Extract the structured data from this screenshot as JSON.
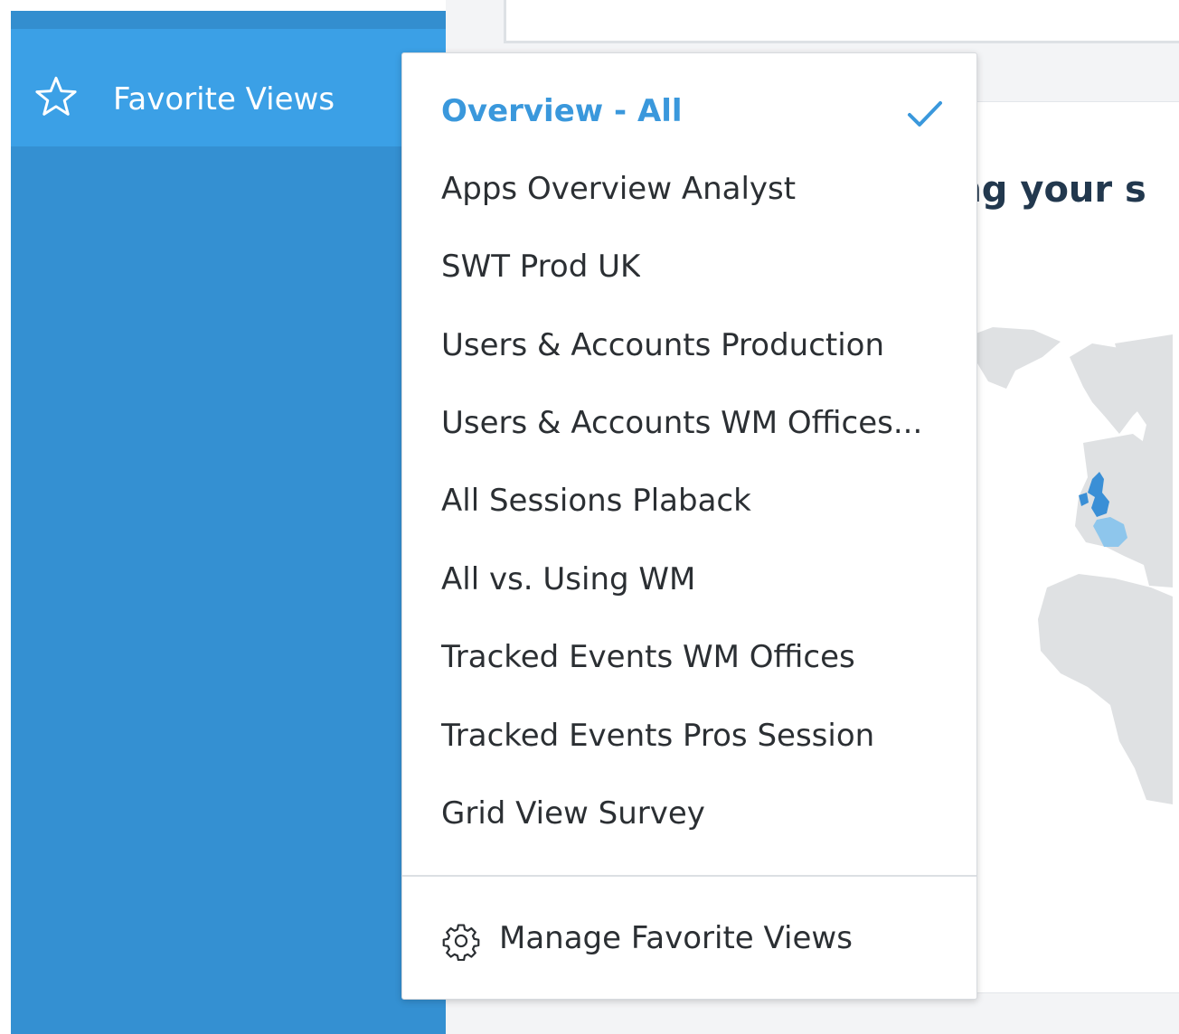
{
  "sidebar": {
    "favorite_views_label": "Favorite Views"
  },
  "main": {
    "heading_partial": "ssing your s"
  },
  "dropdown": {
    "items": [
      {
        "label": "Overview - All",
        "selected": true
      },
      {
        "label": "Apps Overview Analyst",
        "selected": false
      },
      {
        "label": "SWT Prod UK",
        "selected": false
      },
      {
        "label": "Users & Accounts Production",
        "selected": false
      },
      {
        "label": "Users & Accounts WM Offices...",
        "selected": false
      },
      {
        "label": "All Sessions Plaback",
        "selected": false
      },
      {
        "label": "All vs. Using WM",
        "selected": false
      },
      {
        "label": "Tracked Events WM Offices",
        "selected": false
      },
      {
        "label": "Tracked Events Pros Session",
        "selected": false
      },
      {
        "label": "Grid View Survey",
        "selected": false
      }
    ],
    "manage_label": "Manage Favorite Views"
  },
  "icons": {
    "favorite": "star-icon",
    "selected": "checkmark-icon",
    "manage": "gear-icon"
  },
  "colors": {
    "sidebar_bg": "#3490d2",
    "sidebar_active_bg": "#3ba0e6",
    "selected_text": "#3a98dc",
    "menu_text": "#2b2f33",
    "map_land": "#dfe1e3",
    "map_highlight_dark": "#3a8fd6",
    "map_highlight_light": "#8ec6ec"
  }
}
